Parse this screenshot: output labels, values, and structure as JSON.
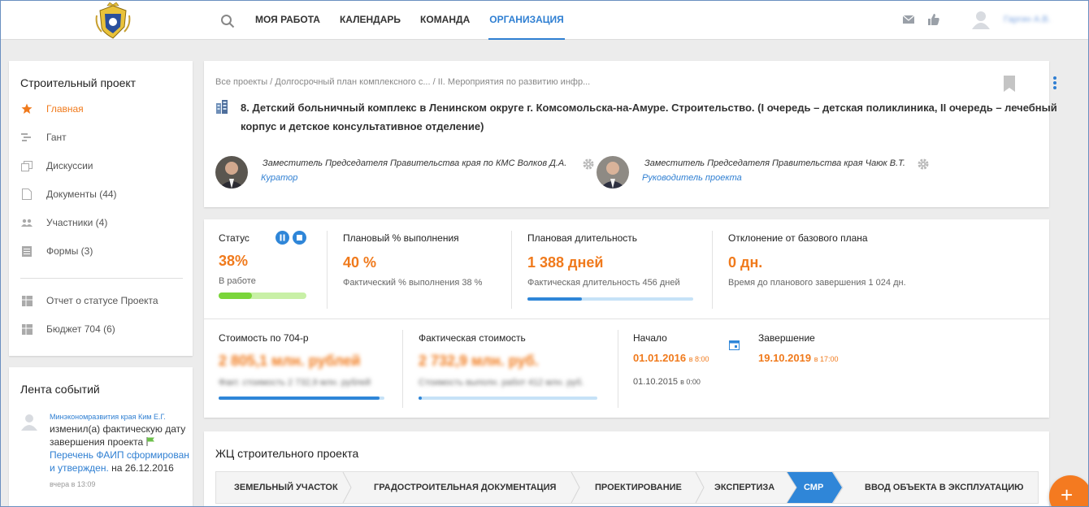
{
  "header": {
    "nav": [
      "МОЯ РАБОТА",
      "КАЛЕНДАРЬ",
      "КОМАНДА",
      "ОРГАНИЗАЦИЯ"
    ],
    "active_nav": "ОРГАНИЗАЦИЯ",
    "user_name": "Гаргин А.В."
  },
  "sidebar": {
    "title": "Строительный проект",
    "items": [
      {
        "label": "Главная",
        "icon": "star-icon"
      },
      {
        "label": "Гант",
        "icon": "gantt-icon"
      },
      {
        "label": "Дискуссии",
        "icon": "discussion-icon"
      },
      {
        "label": "Документы (44)",
        "icon": "document-icon"
      },
      {
        "label": "Участники (4)",
        "icon": "people-icon"
      },
      {
        "label": "Формы (3)",
        "icon": "form-icon"
      }
    ],
    "reports": [
      {
        "label": "Отчет о статусе Проекта",
        "icon": "table-icon"
      },
      {
        "label": "Бюджет 704 (6)",
        "icon": "table-icon"
      }
    ]
  },
  "feed": {
    "title": "Лента событий",
    "author": "Минэкономразвития края Ким Е.Г.",
    "text_before": "изменил(а) фактическую дату завершения проекта",
    "link": "Перечень ФАИП сформирован и утвержден.",
    "text_after": "на 26.12.2016",
    "time": "вчера в 13:09"
  },
  "project": {
    "breadcrumb": [
      "Все проекты",
      "Долгосрочный план комплексного с...",
      "II. Мероприятия по развитию инфр..."
    ],
    "breadcrumb_sep": " / ",
    "title": "8. Детский больничный комплекс в Ленинском округе г. Комсомольска-на-Амуре. Строительство. (I очередь – детская поликлиника, II очередь – лечебный корпус и детское консультативное отделение)",
    "curator": {
      "position": "Заместитель Председателя Правительства края по КМС Волков Д.А.",
      "role": "Куратор"
    },
    "manager": {
      "position": "Заместитель Председателя Правительства края Чаюк В.Т.",
      "role": "Руководитель проекта"
    }
  },
  "stats": {
    "status": {
      "label": "Статус",
      "value": "38%",
      "sub": "В работе",
      "progress": 0.38
    },
    "planned_percent": {
      "label": "Плановый % выполнения",
      "value": "40 %",
      "sub": "Фактический % выполнения 38 %"
    },
    "planned_duration": {
      "label": "Плановая длительность",
      "value": "1 388 дней",
      "sub": "Фактическая длительность 456 дней",
      "progress": 0.33
    },
    "deviation": {
      "label": "Отклонение от базового плана",
      "value": "0 дн.",
      "sub": "Время до планового завершения 1 024 дн."
    },
    "cost_704": {
      "label": "Стоимость по 704-р",
      "value": "2 805,1 млн. рублей",
      "sub": "Факт. стоимость 2 732,9 млн. рублей",
      "progress": 0.97
    },
    "actual_cost": {
      "label": "Фактическая стоимость",
      "value": "2 732,9 млн. руб.",
      "sub": "Стоимость выполн. работ 412 млн. руб.",
      "progress": 0.02
    },
    "start": {
      "label": "Начало",
      "date": "01.01.2016",
      "time": "в 8:00",
      "base_date": "01.10.2015",
      "base_time": "в 0:00"
    },
    "end": {
      "label": "Завершение",
      "date": "19.10.2019",
      "time": "в 17:00"
    }
  },
  "lifecycle": {
    "title": "ЖЦ строительного проекта",
    "steps": [
      "ЗЕМЕЛЬНЫЙ УЧАСТОК",
      "ГРАДОСТРОИТЕЛЬНАЯ ДОКУМЕНТАЦИЯ",
      "ПРОЕКТИРОВАНИЕ",
      "ЭКСПЕРТИЗА",
      "СМР",
      "ВВОД ОБЪЕКТА В ЭКСПЛУАТАЦИЮ"
    ],
    "active_step": "СМР"
  },
  "fab": {
    "label": "+"
  },
  "colors": {
    "accent": "#2f7fd2",
    "orange": "#f07a1c",
    "green": "#7ad53a"
  }
}
